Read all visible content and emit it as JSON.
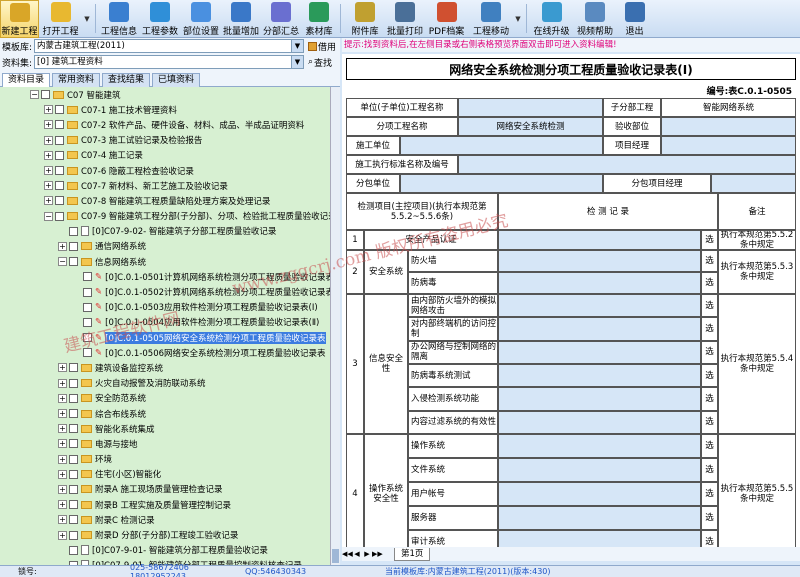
{
  "toolbar": {
    "buttons": [
      {
        "label": "新建工程",
        "icon": "new-project-icon",
        "color": "#d9a628"
      },
      {
        "label": "打开工程",
        "icon": "open-folder-icon",
        "color": "#e8b830"
      },
      {
        "label": "工程信息",
        "icon": "project-info-icon",
        "color": "#3a7fd0"
      },
      {
        "label": "工程参数",
        "icon": "parameters-icon",
        "color": "#2f8fd8"
      },
      {
        "label": "部位设置",
        "icon": "location-settings-icon",
        "color": "#4a90e0"
      },
      {
        "label": "批量增加",
        "icon": "batch-add-icon",
        "color": "#3a78c8"
      },
      {
        "label": "分部汇总",
        "icon": "summary-icon",
        "color": "#6a6fd0"
      },
      {
        "label": "素材库",
        "icon": "material-library-icon",
        "color": "#2a9a5a"
      },
      {
        "label": "附件库",
        "icon": "attachment-icon",
        "color": "#c0a030"
      },
      {
        "label": "批量打印",
        "icon": "printer-icon",
        "color": "#4a6f98"
      },
      {
        "label": "PDF档案",
        "icon": "pdf-icon",
        "color": "#d05030"
      },
      {
        "label": "工程移动",
        "icon": "move-project-icon",
        "color": "#4080c0"
      },
      {
        "label": "在线升级",
        "icon": "online-upgrade-icon",
        "color": "#3a9ad0"
      },
      {
        "label": "视频帮助",
        "icon": "video-help-icon",
        "color": "#5a8ac0"
      },
      {
        "label": "退出",
        "icon": "exit-icon",
        "color": "#3a6fb0"
      }
    ]
  },
  "left": {
    "template_label": "模板库:",
    "template_value": "内蒙古建筑工程(2011)",
    "template_btn": "借用",
    "library_label": "资料集:",
    "library_value": "[0] 建筑工程资料",
    "library_btn": "查找",
    "tabs": [
      "资料目录",
      "常用资料",
      "查找结果",
      "已填资料"
    ],
    "tree": [
      {
        "indent": 30,
        "type": "folder",
        "exp": "-",
        "label": "C07 智能建筑"
      },
      {
        "indent": 44,
        "type": "folder",
        "exp": "+",
        "label": "C07-1 施工技术管理资料"
      },
      {
        "indent": 44,
        "type": "folder",
        "exp": "+",
        "label": "C07-2 软件产品、硬件设备、材料、成品、半成品证明资料"
      },
      {
        "indent": 44,
        "type": "folder",
        "exp": "+",
        "label": "C07-3 施工试验记录及检验报告"
      },
      {
        "indent": 44,
        "type": "folder",
        "exp": "+",
        "label": "C07-4 施工记录"
      },
      {
        "indent": 44,
        "type": "folder",
        "exp": "+",
        "label": "C07-6 隐蔽工程检查验收记录"
      },
      {
        "indent": 44,
        "type": "folder",
        "exp": "+",
        "label": "C07-7 新材料、新工艺施工及验收记录"
      },
      {
        "indent": 44,
        "type": "folder",
        "exp": "+",
        "label": "C07-8 智能建筑工程质量缺陷处理方案及处理记录"
      },
      {
        "indent": 44,
        "type": "folder",
        "exp": "-",
        "label": "C07-9 智能建筑工程分部(子分部)、分项、检验批工程质量验收记录"
      },
      {
        "indent": 58,
        "type": "doc",
        "exp": "",
        "label": "[0]C07-9-02- 智能建筑子分部工程质量验收记录"
      },
      {
        "indent": 58,
        "type": "folder",
        "exp": "+",
        "label": "通信网络系统"
      },
      {
        "indent": 58,
        "type": "folder",
        "exp": "-",
        "label": "信息网络系统"
      },
      {
        "indent": 72,
        "type": "check",
        "exp": "",
        "label": "[0]C.0.1-0501计算机网络系统检测分项工程质量验收记录表"
      },
      {
        "indent": 72,
        "type": "check",
        "exp": "",
        "label": "[0]C.0.1-0502计算机网络系统检测分项工程质量验收记录表"
      },
      {
        "indent": 72,
        "type": "check",
        "exp": "",
        "label": "[0]C.0.1-0503应用软件检测分项工程质量验收记录表(Ⅰ)"
      },
      {
        "indent": 72,
        "type": "check",
        "exp": "",
        "label": "[0]C.0.1-0504应用软件检测分项工程质量验收记录表(Ⅱ)"
      },
      {
        "indent": 72,
        "type": "check",
        "exp": "",
        "label": "[0]C.0.1-0505网络安全系统检测分项工程质量验收记录表",
        "selected": true
      },
      {
        "indent": 72,
        "type": "check",
        "exp": "",
        "label": "[0]C.0.1-0506网络安全系统检测分项工程质量验收记录表"
      },
      {
        "indent": 58,
        "type": "folder",
        "exp": "+",
        "label": "建筑设备监控系统"
      },
      {
        "indent": 58,
        "type": "folder",
        "exp": "+",
        "label": "火灾自动报警及消防联动系统"
      },
      {
        "indent": 58,
        "type": "folder",
        "exp": "+",
        "label": "安全防范系统"
      },
      {
        "indent": 58,
        "type": "folder",
        "exp": "+",
        "label": "综合布线系统"
      },
      {
        "indent": 58,
        "type": "folder",
        "exp": "+",
        "label": "智能化系统集成"
      },
      {
        "indent": 58,
        "type": "folder",
        "exp": "+",
        "label": "电源与接地"
      },
      {
        "indent": 58,
        "type": "folder",
        "exp": "+",
        "label": "环境"
      },
      {
        "indent": 58,
        "type": "folder",
        "exp": "+",
        "label": "住宅(小区)智能化"
      },
      {
        "indent": 58,
        "type": "folder",
        "exp": "+",
        "label": "附录A 施工现场质量管理检查记录"
      },
      {
        "indent": 58,
        "type": "folder",
        "exp": "+",
        "label": "附录B 工程实施及质量管理控制记录"
      },
      {
        "indent": 58,
        "type": "folder",
        "exp": "+",
        "label": "附录C 检测记录"
      },
      {
        "indent": 58,
        "type": "folder",
        "exp": "+",
        "label": "附录D 分部(子分部)工程竣工验收记录"
      },
      {
        "indent": 58,
        "type": "doc",
        "exp": "",
        "label": "[0]C07-9-01- 智能建筑分部工程质量验收记录"
      },
      {
        "indent": 58,
        "type": "doc",
        "exp": "",
        "label": "[0]C07-9-01- 智能建筑分部工程质量控制资料核查记录"
      },
      {
        "indent": 58,
        "type": "doc",
        "exp": "",
        "label": "[0]C07-9-01- 智能建筑分部工程安全和功能检验(检测)核查记录"
      }
    ]
  },
  "hint": "提示:找到资料后,在左侧目录或右侧表格预览界面双击即可进入资料编辑!",
  "form": {
    "title": "网络安全系统检测分项工程质量验收记录表(Ⅰ)",
    "code": "编号:表C.0.1-0505",
    "unit_label": "单位(子单位)工程名称",
    "subdiv_label": "子分部工程",
    "subdiv_value": "智能网络系统",
    "item_label": "分项工程名称",
    "item_value": "网络安全系统检测",
    "inspect_label": "验收部位",
    "construct_label": "施工单位",
    "pm_label": "项目经理",
    "standard_label": "施工执行标准名称及编号",
    "sub_label": "分包单位",
    "sub_pm_label": "分包项目经理",
    "h_items": "检测项目(主控项目)(执行本规范第5.5.2~5.5.6条)",
    "h_record": "检 测 记 录",
    "h_note": "备注",
    "sel": "选",
    "rows": [
      {
        "no": "1",
        "name": "安全产品认证",
        "note": "执行本规范第5.5.2条中规定"
      },
      {
        "no": "2",
        "group": "安全系统",
        "subs": [
          "防火墙",
          "防病毒"
        ],
        "note": "执行本规范第5.5.3条中规定"
      },
      {
        "no": "3",
        "group": "信息安全性",
        "subs": [
          "由内部防火墙外的模拟网络攻击",
          "对内部终端机的访问控制",
          "办公网络与控制网络的隔离",
          "防病毒系统测试",
          "入侵检测系统功能",
          "内容过滤系统的有效性"
        ],
        "note": "执行本规范第5.5.4条中规定"
      },
      {
        "no": "4",
        "group": "操作系统安全性",
        "subs": [
          "操作系统",
          "文件系统",
          "用户帐号",
          "服务器",
          "审计系统"
        ],
        "note": "执行本规范第5.5.5条中规定"
      }
    ]
  },
  "sheet_tab": "第1页",
  "watermarks": [
    "建筑工程软件网",
    "www.zggcrj.com 版权所有盗用必究"
  ],
  "status": {
    "lock_label": "锁号:",
    "phone": "025-58672406 18012952243",
    "qq": "QQ:546430343",
    "current": "当前模板库:内蒙古建筑工程(2011)(版本:430)"
  }
}
